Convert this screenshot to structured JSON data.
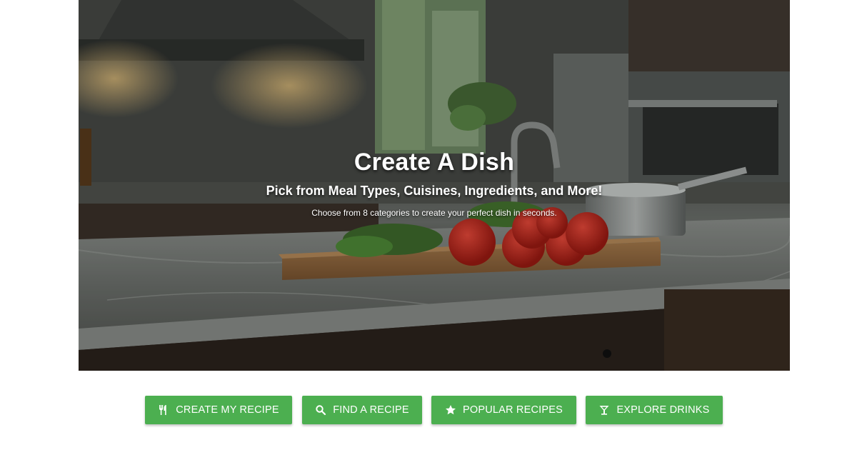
{
  "hero": {
    "title": "Create A Dish",
    "subtitle": "Pick from Meal Types, Cuisines, Ingredients, and More!",
    "caption": "Choose from 8 categories to create your perfect dish in seconds."
  },
  "buttons": [
    {
      "label": "CREATE MY RECIPE",
      "icon": "utensils-icon"
    },
    {
      "label": "FIND A RECIPE",
      "icon": "search-icon"
    },
    {
      "label": "POPULAR RECIPES",
      "icon": "star-icon"
    },
    {
      "label": "EXPLORE DRINKS",
      "icon": "cocktail-icon"
    }
  ],
  "colors": {
    "button_bg": "#4caf50",
    "button_text": "#ffffff",
    "hero_text": "#ffffff"
  }
}
